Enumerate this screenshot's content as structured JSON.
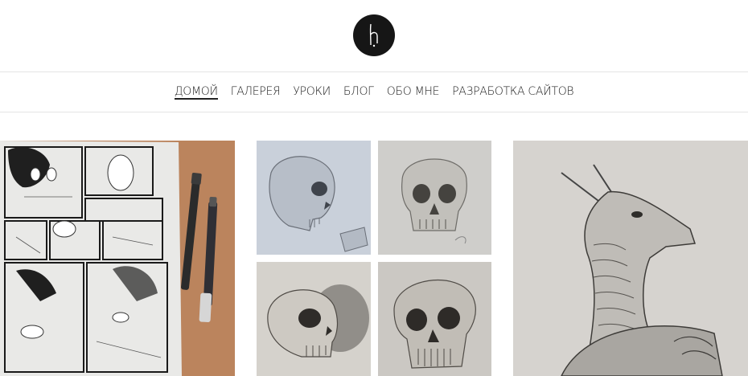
{
  "logo": {
    "icon": "logo-h-icon"
  },
  "nav": {
    "items": [
      {
        "label": "ДОМОЙ",
        "active": true
      },
      {
        "label": "ГАЛЕРЕЯ",
        "active": false
      },
      {
        "label": "УРОКИ",
        "active": false
      },
      {
        "label": "БЛОГ",
        "active": false
      },
      {
        "label": "ОБО МНЕ",
        "active": false
      },
      {
        "label": "РАЗРАБОТКА САЙТОВ",
        "active": false
      }
    ]
  },
  "gallery": {
    "tiles": [
      {
        "subject": "manga-page-with-pens"
      },
      {
        "subject": "skull-sketch-side-view"
      },
      {
        "subject": "skull-sketch-front-view"
      },
      {
        "subject": "skull-sketch-shaded-side"
      },
      {
        "subject": "skull-sketch-shaded-three-quarter"
      },
      {
        "subject": "dragon-sketch"
      }
    ]
  }
}
